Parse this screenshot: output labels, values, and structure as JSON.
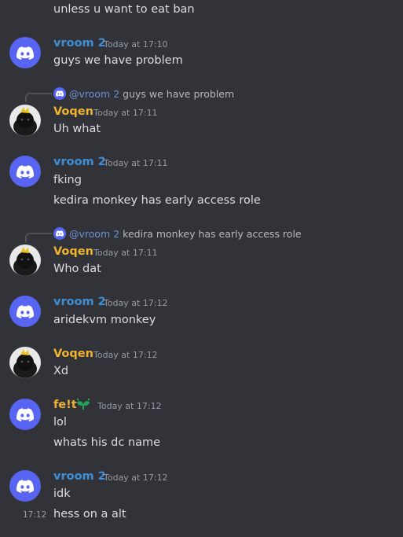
{
  "colors": {
    "background": "#313338",
    "vroom_name": "#3f8fd6",
    "voqen_name": "#f0b232",
    "felt_name": "#f0b232",
    "blurple": "#5865f2"
  },
  "messages": [
    {
      "id": "m0",
      "text": "unless u want to eat ban"
    },
    {
      "id": "m1",
      "author": "vroom 2",
      "timestamp": "Today at 17:10",
      "avatar": "discord-logo-icon",
      "lines": [
        "guys we have problem"
      ]
    },
    {
      "id": "m2",
      "author": "Voqen",
      "timestamp": "Today at 17:11",
      "avatar": "voqen-avatar",
      "reply": {
        "author": "@vroom 2",
        "text": "guys we have problem"
      },
      "lines": [
        "Uh what"
      ]
    },
    {
      "id": "m3",
      "author": "vroom 2",
      "timestamp": "Today at 17:11",
      "avatar": "discord-logo-icon",
      "lines": [
        "fking",
        "kedira monkey has early access role"
      ]
    },
    {
      "id": "m4",
      "author": "Voqen",
      "timestamp": "Today at 17:11",
      "avatar": "voqen-avatar",
      "reply": {
        "author": "@vroom 2",
        "text": "kedira monkey has early access role"
      },
      "lines": [
        "Who dat"
      ]
    },
    {
      "id": "m5",
      "author": "vroom 2",
      "timestamp": "Today at 17:12",
      "avatar": "discord-logo-icon",
      "lines": [
        "aridekvm monkey"
      ]
    },
    {
      "id": "m6",
      "author": "Voqen",
      "timestamp": "Today at 17:12",
      "avatar": "voqen-avatar",
      "lines": [
        "Xd"
      ]
    },
    {
      "id": "m7",
      "author": "fe!t",
      "timestamp": "Today at 17:12",
      "avatar": "discord-logo-icon",
      "badge": "sprout-icon",
      "lines": [
        "lol",
        "whats his dc name"
      ]
    },
    {
      "id": "m8",
      "author": "vroom 2",
      "timestamp": "Today at 17:12",
      "avatar": "discord-logo-icon",
      "lines": [
        "idk",
        "hess on a alt"
      ],
      "hover_time": "17:12"
    }
  ]
}
